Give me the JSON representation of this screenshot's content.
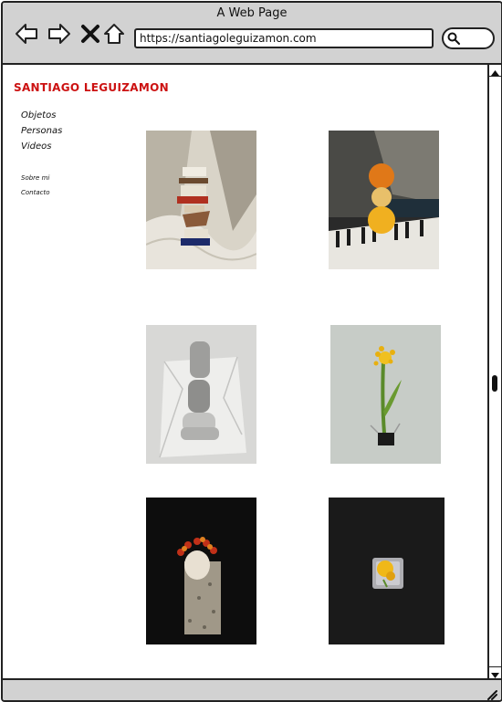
{
  "window": {
    "title": "A Web Page"
  },
  "browser": {
    "url": "https://santiagoleguizamon.com",
    "back_icon": "arrow-left-icon",
    "forward_icon": "arrow-right-icon",
    "stop_icon": "close-icon",
    "home_icon": "home-icon",
    "search_icon": "search-icon"
  },
  "site": {
    "title": "SANTIAGO LEGUIZAMON",
    "accent_color": "#cc1111"
  },
  "nav": {
    "items": [
      "Objetos",
      "Personas",
      "Videos"
    ],
    "secondary": [
      "Sobre mi",
      "Contacto"
    ]
  },
  "gallery": {
    "photos": [
      {
        "subject": "stacked books and objects on bed sheet"
      },
      {
        "subject": "stacked oranges on keyboard"
      },
      {
        "subject": "stacked stones on white paper bag"
      },
      {
        "subject": "yellow flower in binder clip"
      },
      {
        "subject": "flower crown egg on stone"
      },
      {
        "subject": "flower in ice cube"
      }
    ]
  }
}
